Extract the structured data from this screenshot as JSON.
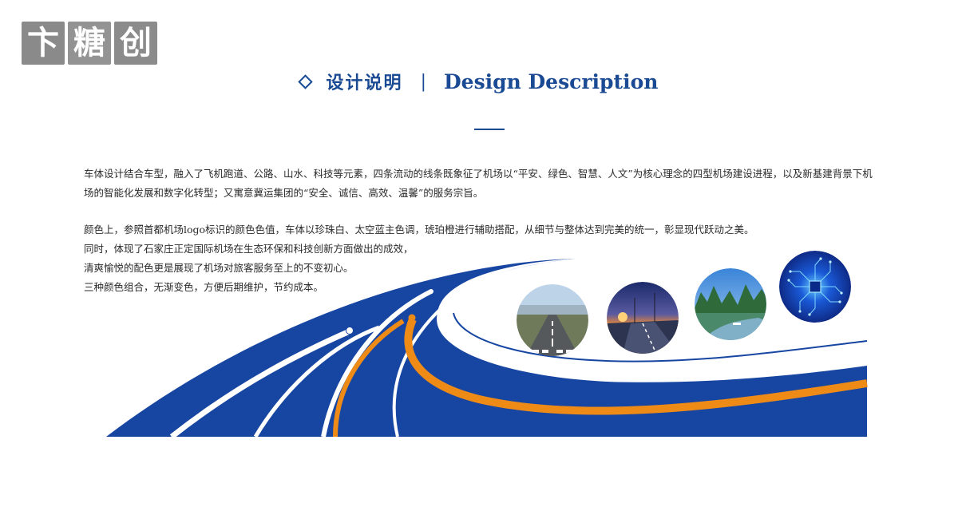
{
  "logo": {
    "chars": [
      "卞",
      "糖",
      "创"
    ]
  },
  "header": {
    "title_cn": "设计说明",
    "separator": "|",
    "title_en": "Design Description"
  },
  "intro": "车体设计结合车型，融入了飞机跑道、公路、山水、科技等元素，四条流动的线条既象征了机场以“平安、绿色、智慧、人文”为核心理念的四型机场建设进程，以及新基建背景下机场的智能化发展和数字化转型；又寓意冀运集团的“安全、诚信、高效、温馨”的服务宗旨。",
  "lines": [
    "颜色上，参照首都机场logo标识的颜色色值，车体以珍珠白、太空蓝主色调，琥珀橙进行辅助搭配，从细节与整体达到完美的统一，彰显现代跃动之美。",
    "同时，体现了石家庄正定国际机场在生态环保和科技创新方面做出的成效，",
    "清爽愉悦的配色更是展现了机场对旅客服务至上的不变初心。",
    "三种颜色组合，无渐变色，方便后期维护，节约成本。"
  ],
  "photos": [
    "runway",
    "highway at sunset",
    "river and karst hills",
    "technology circuit"
  ],
  "colors": {
    "space_blue": "#1746a2",
    "amber_orange": "#ee8a16",
    "pearl_white": "#ffffff",
    "heading": "#1a4a93"
  }
}
